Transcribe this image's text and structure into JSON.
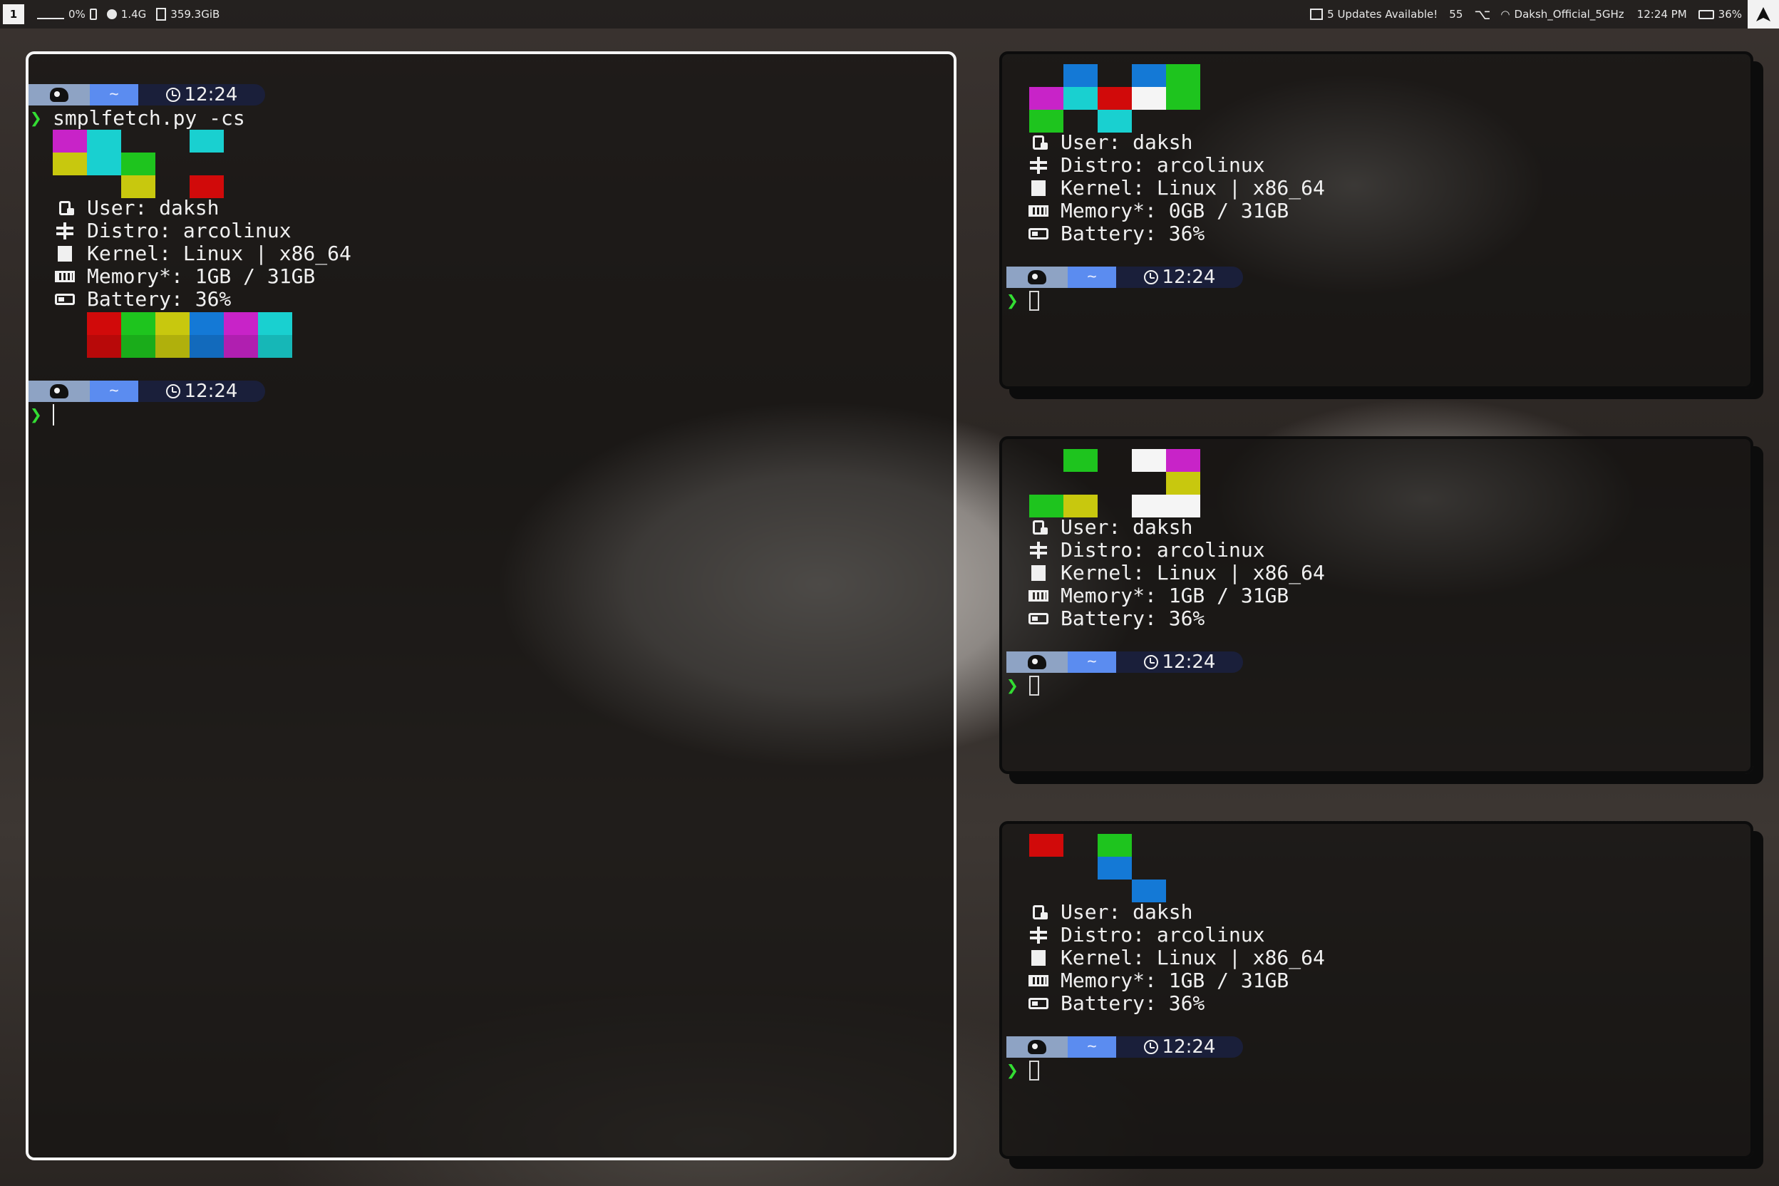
{
  "colors": {
    "red": "#d10a0a",
    "green": "#1ec41e",
    "yellow": "#c8c80e",
    "blue": "#1479d6",
    "magenta": "#c823c8",
    "cyan": "#19d0d0",
    "white": "#f5f5f5",
    "prompt_seg1": "#8ea3c4",
    "prompt_seg2": "#5b8cf0",
    "prompt_seg3": "#1a1f3a",
    "prompt_arrow": "#33dd33"
  },
  "topbar": {
    "workspace": "1",
    "cpu": "0%",
    "memory": "1.4G",
    "disk": "359.3GiB",
    "updates": "5 Updates Available!",
    "count": "55",
    "wifi": "Daksh_Official_5GHz",
    "time": "12:24 PM",
    "battery": "36%"
  },
  "prompt": {
    "home": "~",
    "time": "12:24",
    "arrow": "❯"
  },
  "left_window": {
    "command": "smplfetch.py -cs",
    "user": "User: daksh",
    "distro": "Distro: arcolinux",
    "kernel": "Kernel: Linux | x86_64",
    "memory": "Memory*: 1GB / 31GB",
    "battery": "Battery: 36%"
  },
  "right_top": {
    "user": "User: daksh",
    "distro": "Distro: arcolinux",
    "kernel": "Kernel: Linux | x86_64",
    "memory": "Memory*: 0GB / 31GB",
    "battery": "Battery: 36%"
  },
  "right_mid": {
    "user": "User: daksh",
    "distro": "Distro: arcolinux",
    "kernel": "Kernel: Linux | x86_64",
    "memory": "Memory*: 1GB / 31GB",
    "battery": "Battery: 36%"
  },
  "right_bottom": {
    "user": "User: daksh",
    "distro": "Distro: arcolinux",
    "kernel": "Kernel: Linux | x86_64",
    "memory": "Memory*: 1GB / 31GB",
    "battery": "Battery: 36%"
  },
  "pixel_art": {
    "left": [
      [
        "magenta",
        "cyan",
        null,
        null,
        "cyan"
      ],
      [
        "yellow",
        "cyan",
        "green",
        null,
        null
      ],
      [
        null,
        null,
        "yellow",
        null,
        "red"
      ]
    ],
    "palette": [
      "red",
      "green",
      "yellow",
      "blue",
      "magenta",
      "cyan"
    ],
    "right_top": [
      [
        null,
        "blue",
        null,
        "blue",
        "green"
      ],
      [
        "magenta",
        "cyan",
        "red",
        "white",
        "green"
      ],
      [
        "green",
        null,
        "cyan",
        null,
        null
      ]
    ],
    "right_mid": [
      [
        null,
        "green",
        null,
        "white",
        "magenta"
      ],
      [
        null,
        null,
        null,
        null,
        "yellow"
      ],
      [
        "green",
        "yellow",
        null,
        "white",
        "white"
      ]
    ],
    "right_bottom": [
      [
        "red",
        null,
        "green",
        null,
        null
      ],
      [
        null,
        null,
        "blue",
        null,
        null
      ],
      [
        null,
        null,
        null,
        "blue",
        null
      ]
    ]
  }
}
